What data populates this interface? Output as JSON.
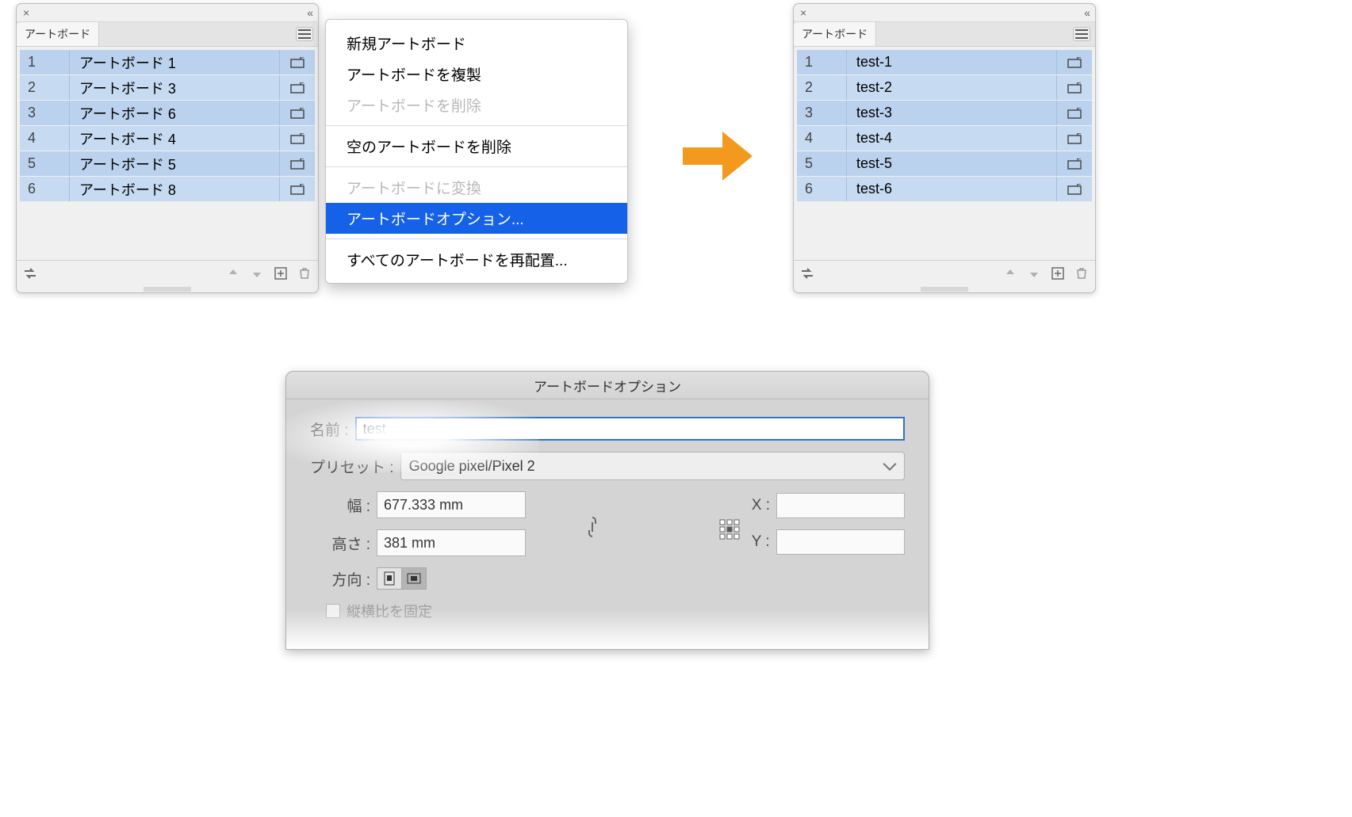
{
  "panel_left": {
    "tab": "アートボード",
    "rows": [
      {
        "index": "1",
        "name": "アートボード 1"
      },
      {
        "index": "2",
        "name": "アートボード 3"
      },
      {
        "index": "3",
        "name": "アートボード 6"
      },
      {
        "index": "4",
        "name": "アートボード 4"
      },
      {
        "index": "5",
        "name": "アートボード 5"
      },
      {
        "index": "6",
        "name": "アートボード 8"
      }
    ]
  },
  "panel_right": {
    "tab": "アートボード",
    "rows": [
      {
        "index": "1",
        "name": "test-1"
      },
      {
        "index": "2",
        "name": "test-2"
      },
      {
        "index": "3",
        "name": "test-3"
      },
      {
        "index": "4",
        "name": "test-4"
      },
      {
        "index": "5",
        "name": "test-5"
      },
      {
        "index": "6",
        "name": "test-6"
      }
    ]
  },
  "menu": {
    "new": "新規アートボード",
    "duplicate": "アートボードを複製",
    "delete": "アートボードを削除",
    "delEmpty": "空のアートボードを削除",
    "convert": "アートボードに変換",
    "options": "アートボードオプション...",
    "rearrange": "すべてのアートボードを再配置..."
  },
  "options": {
    "title": "アートボードオプション",
    "name_label": "名前 :",
    "name_value": "test",
    "preset_label": "プリセット :",
    "preset_value": "Google pixel/Pixel 2",
    "width_label": "幅 :",
    "width_value": "677.333 mm",
    "height_label": "高さ :",
    "height_value": "381 mm",
    "x_label": "X :",
    "y_label": "Y :",
    "orient_label": "方向 :",
    "lock_ratio": "縦横比を固定"
  }
}
